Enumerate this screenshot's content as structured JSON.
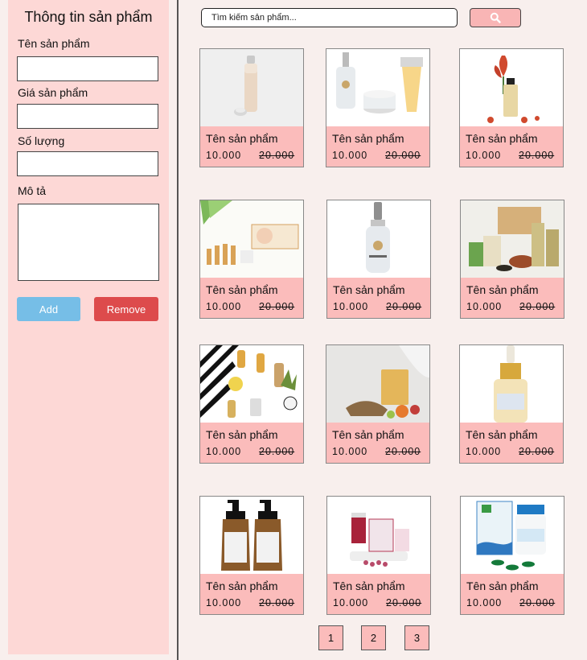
{
  "sidebar": {
    "title": "Thông tin sản phẩm",
    "fields": [
      {
        "label": "Tên sản phẩm",
        "value": ""
      },
      {
        "label": "Giá sản phẩm",
        "value": ""
      },
      {
        "label": "Số lượng",
        "value": ""
      },
      {
        "label": "Mô tả",
        "value": ""
      }
    ],
    "add_label": "Add",
    "remove_label": "Remove"
  },
  "search": {
    "placeholder": "Tìm kiếm sản phẩm...",
    "icon": "search-icon"
  },
  "products": [
    {
      "name": "Tên sản phẩm",
      "price": "10.000",
      "old_price": "20.000",
      "image": "foundation-bottle"
    },
    {
      "name": "Tên sản phẩm",
      "price": "10.000",
      "old_price": "20.000",
      "image": "serum-cream-set"
    },
    {
      "name": "Tên sản phẩm",
      "price": "10.000",
      "old_price": "20.000",
      "image": "flower-perfume"
    },
    {
      "name": "Tên sản phẩm",
      "price": "10.000",
      "old_price": "20.000",
      "image": "collagen-set"
    },
    {
      "name": "Tên sản phẩm",
      "price": "10.000",
      "old_price": "20.000",
      "image": "serum-dropper-bottle"
    },
    {
      "name": "Tên sản phẩm",
      "price": "10.000",
      "old_price": "20.000",
      "image": "herbal-tea-boxes"
    },
    {
      "name": "Tên sản phẩm",
      "price": "10.000",
      "old_price": "20.000",
      "image": "oil-bottles-flatlay"
    },
    {
      "name": "Tên sản phẩm",
      "price": "10.000",
      "old_price": "20.000",
      "image": "mask-sachet"
    },
    {
      "name": "Tên sản phẩm",
      "price": "10.000",
      "old_price": "20.000",
      "image": "gold-dropper-bottle"
    },
    {
      "name": "Tên sản phẩm",
      "price": "10.000",
      "old_price": "20.000",
      "image": "pump-bottles"
    },
    {
      "name": "Tên sản phẩm",
      "price": "10.000",
      "old_price": "20.000",
      "image": "supplement-boxes"
    },
    {
      "name": "Tên sản phẩm",
      "price": "10.000",
      "old_price": "20.000",
      "image": "capsule-jar"
    }
  ],
  "pagination": [
    "1",
    "2",
    "3"
  ],
  "colors": {
    "background": "#f8efed",
    "sidebar": "#fdd8d6",
    "card_info": "#fbbcbb",
    "add_button": "#76bee7",
    "remove_button": "#dd4b4c",
    "search_button": "#f9b5b5"
  }
}
